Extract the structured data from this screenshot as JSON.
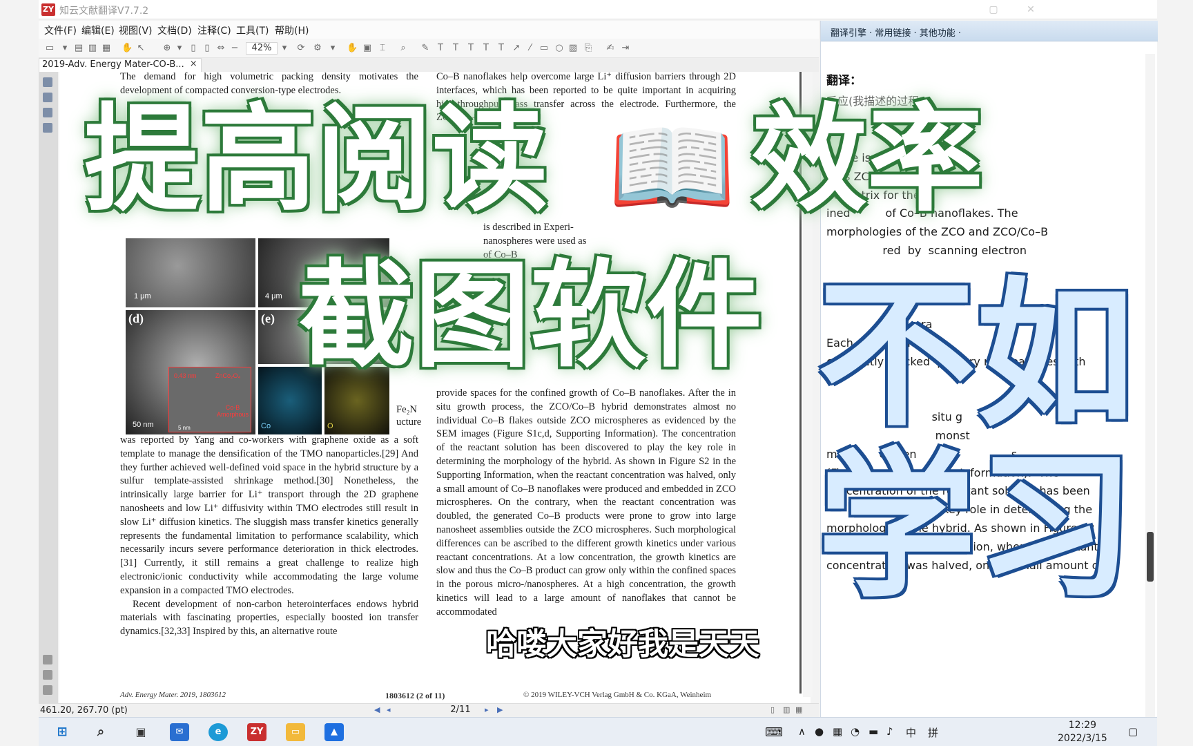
{
  "window": {
    "logo": "ZY",
    "title": "知云文献翻译V7.7.2",
    "minimize": "▢",
    "close": "✕"
  },
  "menu": [
    "文件(F)",
    "编辑(E)",
    "视图(V)",
    "文档(D)",
    "注释(C)",
    "工具(T)",
    "帮助(H)"
  ],
  "toolbar": {
    "zoom": "42%"
  },
  "tab": {
    "label": "2019-Adv. Energy Mater-CO-B...",
    "close": "×"
  },
  "pdf": {
    "left_column": [
      "The demand for high volumetric packing density motivates the development of compacted conversion-type electrodes.",
      "was reported by Yang and co-workers with graphene oxide as a soft template to manage the densification of the TMO nanoparticles.[29] And they further achieved well-defined void space in the hybrid structure by a sulfur template-assisted shrinkage method.[30] Nonetheless, the intrinsically large barrier for Li⁺ transport through the 2D graphene nanosheets and low Li⁺ diffusivity within TMO electrodes still result in slow Li⁺ diffusion kinetics. The sluggish mass transfer kinetics generally represents the fundamental limitation to performance scalability, which necessarily incurs severe performance deterioration in thick electrodes.[31] Currently, it still remains a great challenge to realize high electronic/ionic conductivity while accommodating the large volume expansion in a compacted TMO electrodes.",
      "Recent development of non-carbon heterointerfaces endows hybrid materials with fascinating properties, especially boosted ion transfer dynamics.[32,33] Inspired by this, an alternative route"
    ],
    "right_column": [
      "Co–B nanoflakes help overcome large Li⁺ diffusion barriers through 2D interfaces, which has been reported to be quite important in acquiring high-throughput mass transfer across the electrode. Furthermore, the ZCO/Co–B hybrid can be",
      "provide spaces for the confined growth of Co–B nanoflakes. After the in situ growth process, the ZCO/Co–B hybrid demonstrates almost no individual Co–B flakes outside ZCO microspheres as evidenced by the SEM images (Figure S1c,d, Supporting Information). The concentration of the reactant solution has been discovered to play the key role in determining the morphology of the hybrid. As shown in Figure S2 in the Supporting Information, when the reactant concentration was halved, only a small amount of Co–B nanoflakes were produced and embedded in ZCO microspheres. On the contrary, when the reactant concentration was doubled, the generated Co–B products were prone to grow into large nanosheet assemblies outside the ZCO microspheres. Such morphological differences can be ascribed to the different growth kinetics under various reactant concentrations. At a low concentration, the growth kinetics are slow and thus the Co–B product can grow only within the confined spaces in the porous micro-/nanospheres. At a high concentration, the growth kinetics will lead to a large amount of nanoflakes that cannot be accommodated"
    ],
    "right_partial": [
      "is described in Experi-",
      "nanospheres were used as",
      "of Co–B"
    ],
    "figure": {
      "label_d": "(d)",
      "label_e": "(e)",
      "scale_a": "1 μm",
      "scale_b": "4 μm",
      "scale_d": "50 nm",
      "scale_d2": "5 nm",
      "lattice": "0.43 nm",
      "phase": "ZnCo₂O₄",
      "amorphous": "Co-B Amorphous",
      "map_co": "Co",
      "map_o": "O",
      "side_fe": "Fe₂N",
      "side_ucture": "ucture"
    },
    "footer_left": "Adv. Energy Mater. 2019, 1803612",
    "footer_center": "1803612  (2 of 11)",
    "footer_right": "© 2019 WILEY-VCH Verlag GmbH & Co. KGaA, Weinheim"
  },
  "status": {
    "coords": "461.20, 267.70 (pt)",
    "page": "2/11"
  },
  "translation": {
    "header": "翻译引擎 · 常用链接 · 其他功能 ·",
    "heading": "翻译：",
    "line_top": "反应(我描述的过程",
    "lines": [
      "edure is described",
      "rous ZCO micro-",
      "he matrix for the",
      "ined          of Co–B nanoflakes. The",
      "morphologies of the ZCO and ZCO/Co–B",
      "                red  by  scanning electron",
      "",
      "Figure                 ure",
      "",
      "                        e ra",
      "Each  r           here  is",
      "compactly stacked  primary nanoparticles with",
      "",
      "",
      "                              situ g",
      "                               monst",
      "m            eviden                           s",
      "(Fi               Supporting  Information).  The",
      "concentration of the reactant solution has been",
      "       ered to play the key role in determining the",
      "morphology of the hybrid. As shown in Figure S2",
      "in the Supporting Information, when the reactant",
      "concentration was halved, only a small amount of"
    ]
  },
  "overlay": {
    "line1": "提高阅读",
    "book": "📖",
    "line1b": "效率",
    "line2": "截图软件",
    "blue1": "不如",
    "blue2": "学习",
    "subtitle": "哈喽大家好我是天天"
  },
  "taskbar": {
    "zy": "ZY",
    "ime_zh": "中",
    "ime_pin": "拼",
    "time": "12:29",
    "date": "2022/3/15"
  }
}
